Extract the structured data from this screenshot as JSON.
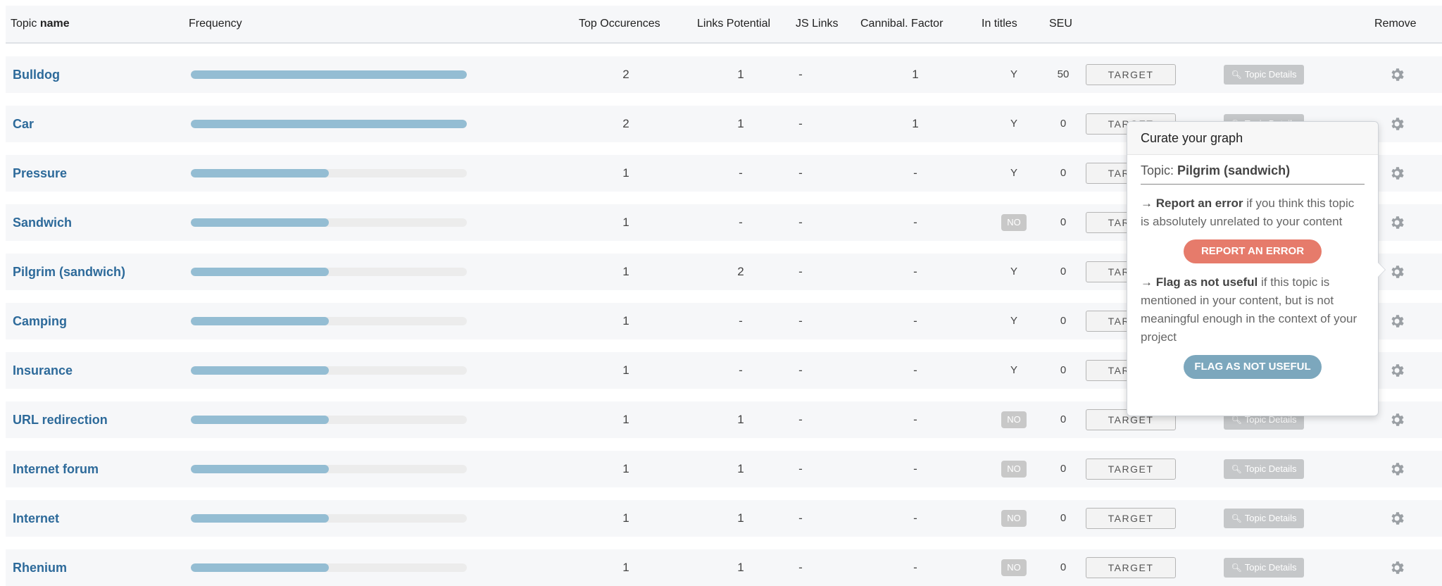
{
  "header": {
    "topic_prefix": "Topic",
    "topic_name": "name",
    "frequency": "Frequency",
    "top_occurences": "Top Occurences",
    "links_potential": "Links Potential",
    "js_links": "JS Links",
    "cannibal_factor": "Cannibal. Factor",
    "in_titles": "In titles",
    "seu": "SEU",
    "remove": "Remove"
  },
  "buttons": {
    "target_label": "TARGET",
    "details_label": "Topic Details"
  },
  "colors": {
    "link": "#2d6a9a",
    "bar_fill": "#94bdd3",
    "bar_track": "#ececec",
    "report_button": "#e67b6b",
    "flag_button": "#7ca7bd"
  },
  "rows": [
    {
      "topic": "Bulldog",
      "frequency": 1.0,
      "top": "2",
      "links": "1",
      "js": "-",
      "cannibal": "1",
      "in_titles": "Y",
      "seu": "50"
    },
    {
      "topic": "Car",
      "frequency": 1.0,
      "top": "2",
      "links": "1",
      "js": "-",
      "cannibal": "1",
      "in_titles": "Y",
      "seu": "0"
    },
    {
      "topic": "Pressure",
      "frequency": 0.5,
      "top": "1",
      "links": "-",
      "js": "-",
      "cannibal": "-",
      "in_titles": "Y",
      "seu": "0"
    },
    {
      "topic": "Sandwich",
      "frequency": 0.5,
      "top": "1",
      "links": "-",
      "js": "-",
      "cannibal": "-",
      "in_titles": "NO",
      "seu": "0"
    },
    {
      "topic": "Pilgrim (sandwich)",
      "frequency": 0.5,
      "top": "1",
      "links": "2",
      "js": "-",
      "cannibal": "-",
      "in_titles": "Y",
      "seu": "0"
    },
    {
      "topic": "Camping",
      "frequency": 0.5,
      "top": "1",
      "links": "-",
      "js": "-",
      "cannibal": "-",
      "in_titles": "Y",
      "seu": "0"
    },
    {
      "topic": "Insurance",
      "frequency": 0.5,
      "top": "1",
      "links": "-",
      "js": "-",
      "cannibal": "-",
      "in_titles": "Y",
      "seu": "0"
    },
    {
      "topic": "URL redirection",
      "frequency": 0.5,
      "top": "1",
      "links": "1",
      "js": "-",
      "cannibal": "-",
      "in_titles": "NO",
      "seu": "0"
    },
    {
      "topic": "Internet forum",
      "frequency": 0.5,
      "top": "1",
      "links": "1",
      "js": "-",
      "cannibal": "-",
      "in_titles": "NO",
      "seu": "0"
    },
    {
      "topic": "Internet",
      "frequency": 0.5,
      "top": "1",
      "links": "1",
      "js": "-",
      "cannibal": "-",
      "in_titles": "NO",
      "seu": "0"
    },
    {
      "topic": "Rhenium",
      "frequency": 0.5,
      "top": "1",
      "links": "1",
      "js": "-",
      "cannibal": "-",
      "in_titles": "NO",
      "seu": "0"
    }
  ],
  "popover": {
    "title": "Curate your graph",
    "topic_prefix": "Topic:",
    "topic_name": "Pilgrim (sandwich)",
    "report_bold": "Report an error",
    "report_text": " if you think this topic is absolutely unrelated to your content",
    "report_button": "REPORT AN ERROR",
    "flag_bold": "Flag as not useful",
    "flag_text": " if this topic is mentioned in your content, but is not meaningful enough in the context of your project",
    "flag_button": "FLAG AS NOT USEFUL"
  }
}
